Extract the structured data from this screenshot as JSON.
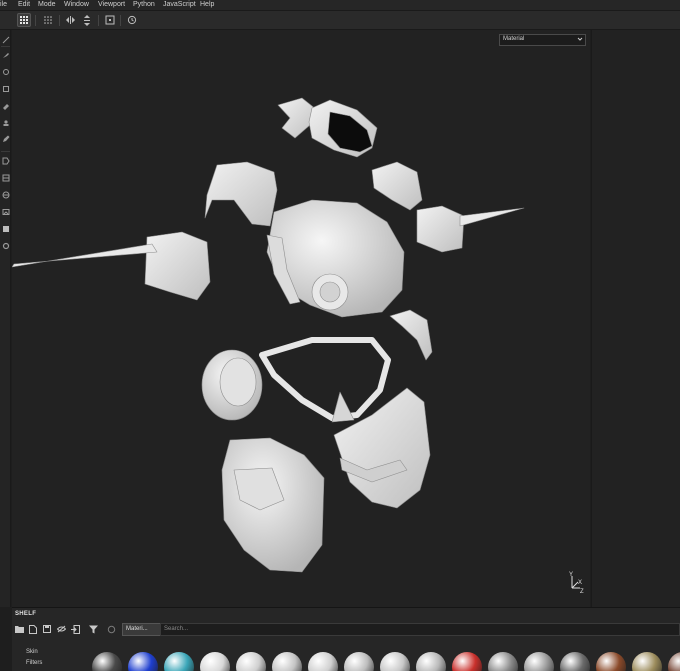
{
  "menubar": {
    "items": [
      "ile",
      "Edit",
      "Mode",
      "Window",
      "Viewport",
      "Python",
      "JavaScript",
      "Help"
    ]
  },
  "toolbar": {
    "icons": [
      "grid-view-icon",
      "grid-dots-icon",
      "mirror-icon",
      "center-pivot-icon",
      "frame-icon",
      "history-icon"
    ]
  },
  "viewport": {
    "shading_mode": "Material",
    "axis_labels": {
      "y": "Y",
      "x": "X",
      "z": "Z"
    }
  },
  "shelf": {
    "title": "SHELF",
    "active_tab": "Materi...",
    "tab_close": "×",
    "search_placeholder": "Search...",
    "categories": [
      "Skin",
      "Filters"
    ],
    "material_colors": [
      "#4a4a4a",
      "#1f3fcf",
      "#3aa6b8",
      "#d8d8d8",
      "#cfcfcf",
      "#c4c4c4",
      "#d0d0d0",
      "#bdbdbd",
      "#c8c8c8",
      "#b8b8b8",
      "#c9302c",
      "#8a8a8a",
      "#9a9a9a",
      "#6a6a6a",
      "#8b4a2a",
      "#9c8c5c",
      "#7a4a3a"
    ]
  }
}
